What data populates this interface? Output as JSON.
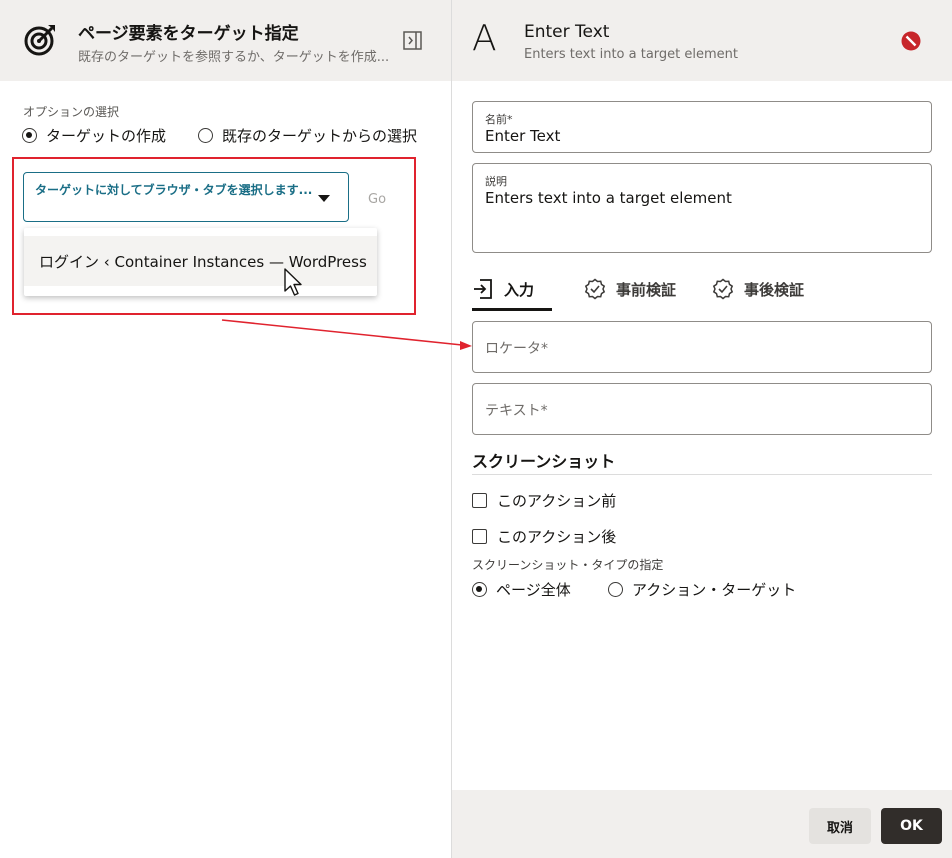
{
  "left_panel": {
    "title": "ページ要素をターゲット指定",
    "subtitle": "既存のターゲットを参照するか、ターゲットを作成...",
    "options_label": "オプションの選択",
    "option_create": "ターゲットの作成",
    "option_existing": "既存のターゲットからの選択",
    "select_placeholder": "ターゲットに対してブラウザ・タブを選択します...",
    "go_label": "Go",
    "dropdown_items": [
      "ログイン ‹ Container Instances — WordPress"
    ]
  },
  "right_panel": {
    "title": "Enter Text",
    "subtitle": "Enters text into a target element",
    "name_label": "名前*",
    "name_value": "Enter Text",
    "desc_label": "説明",
    "desc_value": "Enters text into a target element",
    "tabs": [
      "入力",
      "事前検証",
      "事後検証"
    ],
    "locator_placeholder": "ロケータ*",
    "text_placeholder": "テキスト*",
    "screenshot_title": "スクリーンショット",
    "check_before": "このアクション前",
    "check_after": "このアクション後",
    "screenshot_type_label": "スクリーンショット・タイプの指定",
    "type_full_page": "ページ全体",
    "type_action_target": "アクション・ターゲット",
    "cancel_label": "取消",
    "ok_label": "OK"
  },
  "colors": {
    "accent_teal": "#1a6e86",
    "highlight_red": "#e0232e",
    "header_bg": "#f1efed",
    "ok_button": "#312d2a",
    "stop_icon": "#c7262a"
  }
}
